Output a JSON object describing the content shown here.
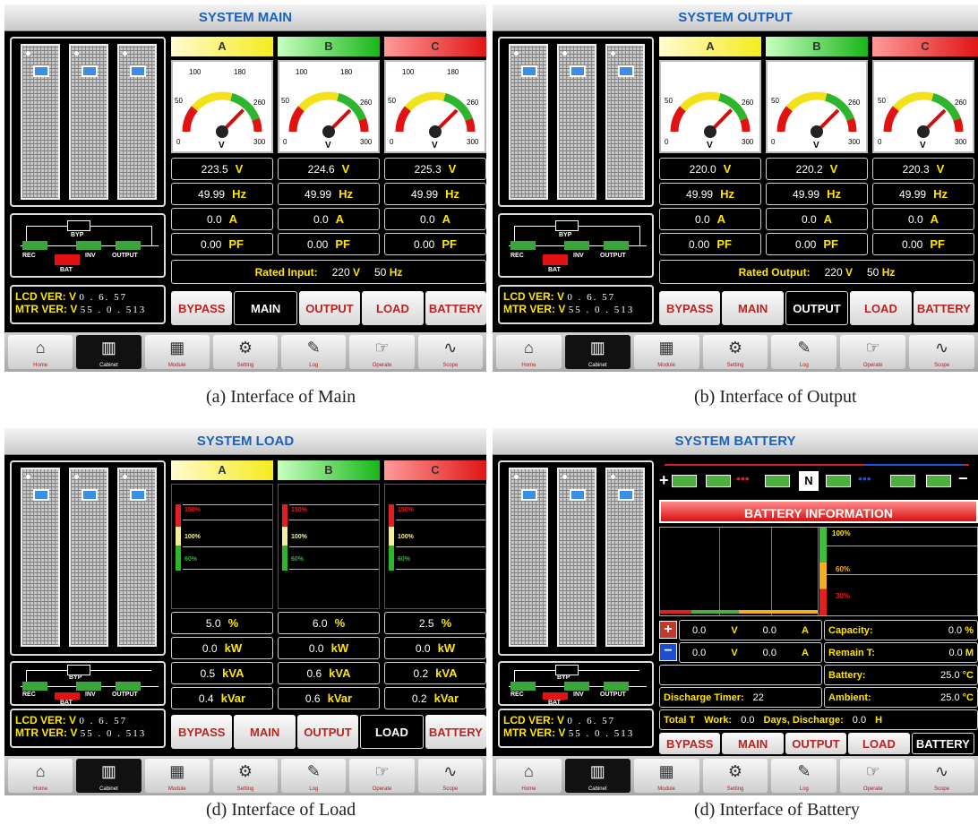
{
  "common": {
    "lcd_label": "LCD VER: V",
    "lcd_value": "0 .   6. 57",
    "mtr_label": "MTR VER: V",
    "mtr_value": "55 . 0 . 513",
    "tabs": [
      "BYPASS",
      "MAIN",
      "OUTPUT",
      "LOAD",
      "BATTERY"
    ],
    "nav": [
      "Home",
      "Cabinet",
      "Module",
      "Setting",
      "Log",
      "Operate",
      "Scope"
    ],
    "flow": {
      "byp": "BYP",
      "rec": "REC",
      "inv": "INV",
      "output": "OUTPUT",
      "bat": "BAT"
    },
    "phases": [
      "A",
      "B",
      "C"
    ]
  },
  "main": {
    "title": "SYSTEM MAIN",
    "caption": "(a) Interface of Main",
    "gauge_ticks": [
      "100",
      "180",
      "50",
      "260",
      "0",
      "300"
    ],
    "gauge_unit": "V",
    "volts": [
      "223.5",
      "224.6",
      "225.3"
    ],
    "hz": [
      "49.99",
      "49.99",
      "49.99"
    ],
    "amps": [
      "0.0",
      "0.0",
      "0.0"
    ],
    "pf": [
      "0.00",
      "0.00",
      "0.00"
    ],
    "units": {
      "v": "V",
      "hz": "Hz",
      "a": "A",
      "pf": "PF"
    },
    "rated_label": "Rated Input:",
    "rated_v": "220",
    "rated_v_unit": "V",
    "rated_hz": "50",
    "rated_hz_unit": "Hz",
    "gauge_needle": [
      223.5,
      224.6,
      225.3
    ]
  },
  "output": {
    "title": "SYSTEM OUTPUT",
    "caption": "(b) Interface of Output",
    "volts": [
      "220.0",
      "220.2",
      "220.3"
    ],
    "hz": [
      "49.99",
      "49.99",
      "49.99"
    ],
    "amps": [
      "0.0",
      "0.0",
      "0.0"
    ],
    "pf": [
      "0.00",
      "0.00",
      "0.00"
    ],
    "rated_label": "Rated Output:",
    "rated_v": "220",
    "rated_v_unit": "V",
    "rated_hz": "50",
    "rated_hz_unit": "Hz"
  },
  "load": {
    "title": "SYSTEM LOAD",
    "caption": "(d) Interface of Load",
    "levels": [
      "150%",
      "100%",
      "60%"
    ],
    "pct": [
      "5.0",
      "6.0",
      "2.5"
    ],
    "kw": [
      "0.0",
      "0.0",
      "0.0"
    ],
    "kva": [
      "0.5",
      "0.6",
      "0.2"
    ],
    "kvar": [
      "0.4",
      "0.6",
      "0.2"
    ],
    "units": {
      "pct": "%",
      "kw": "kW",
      "kva": "kVA",
      "kvar": "kVar"
    }
  },
  "battery": {
    "title": "SYSTEM BATTERY",
    "caption": "(d) Interface of Battery",
    "info": "BATTERY INFORMATION",
    "n": "N",
    "levels": [
      "100%",
      "60%",
      "30%"
    ],
    "row1": {
      "v": "0.0",
      "vu": "V",
      "a": "0.0",
      "au": "A",
      "label": "Capacity:",
      "val": "0.0",
      "unit": "%"
    },
    "row2": {
      "v": "0.0",
      "vu": "V",
      "a": "0.0",
      "au": "A",
      "label": "Remain T:",
      "val": "0.0",
      "unit": "M"
    },
    "battery_label": "Battery:",
    "battery_val": "25.0",
    "battery_unit": "°C",
    "discharge_label": "Discharge Timer:",
    "discharge_val": "22",
    "ambient_label": "Ambient:",
    "ambient_val": "25.0",
    "ambient_unit": "°C",
    "total_label": "Total T",
    "work_label": "Work:",
    "work_val": "0.0",
    "days_label": "Days, Discharge:",
    "days_val": "0.0",
    "days_unit": "H"
  }
}
